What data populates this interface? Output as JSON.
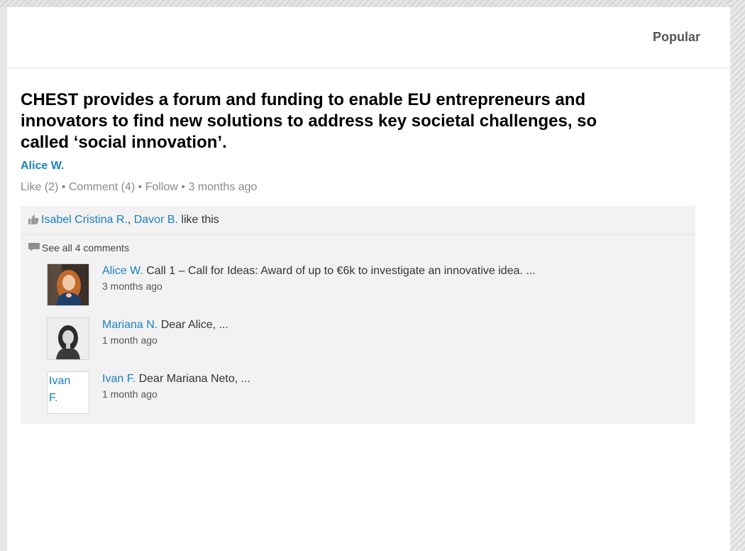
{
  "header": {
    "popular_label": "Popular"
  },
  "post": {
    "title": "CHEST provides a forum and funding to enable EU entrepreneurs and innovators to find new solutions to address key societal challenges, so called ‘social innovation’.",
    "author": "Alice W.",
    "actions": {
      "like": "Like (2)",
      "comment": "Comment (4)",
      "follow": "Follow",
      "separator": " • ",
      "time": "3 months ago"
    }
  },
  "likes": {
    "icon": "thumbs-up-icon",
    "user1": "Isabel Cristina R.",
    "separator": ", ",
    "user2": "Davor B.",
    "suffix": " like this"
  },
  "comments": {
    "icon": "speech-bubble-icon",
    "see_all": "See all 4 comments",
    "items": [
      {
        "author": "Alice W.",
        "text": " Call 1 – Call for Ideas: Award of up to €6k to investigate an innovative idea. ...",
        "time": "3 months ago",
        "avatar": "photo"
      },
      {
        "author": "Mariana N.",
        "text": " Dear Alice, ...",
        "time": "1 month ago",
        "avatar": "photo"
      },
      {
        "author": "Ivan F.",
        "text": " Dear Mariana Neto, ...",
        "time": "1 month ago",
        "avatar": "Ivan F.",
        "avatar_line1": "Ivan",
        "avatar_line2": "F."
      }
    ]
  },
  "colors": {
    "link": "#1a7fbf",
    "panel": "#f2f2f2",
    "muted": "#8a8a8a"
  }
}
